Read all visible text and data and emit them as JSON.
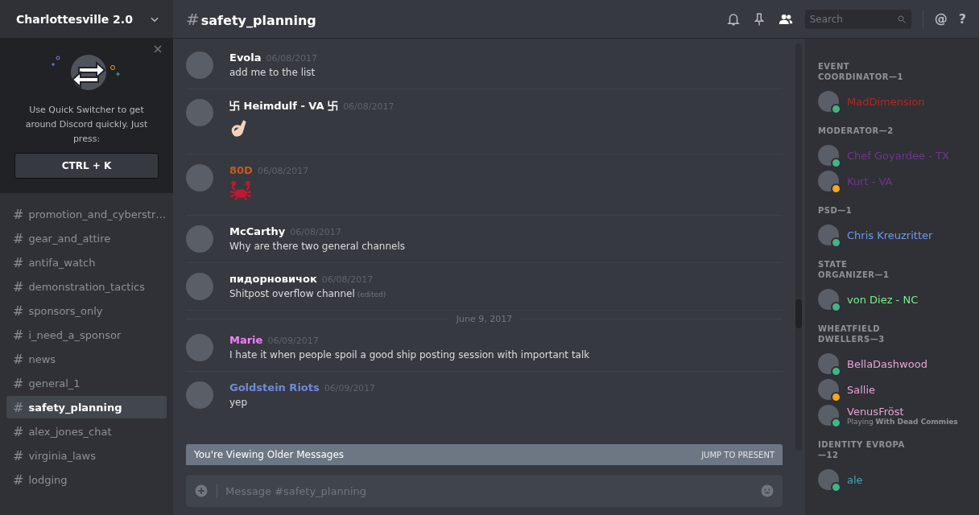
{
  "server": {
    "name": "Charlottesville 2.0"
  },
  "tip": {
    "text": "Use Quick Switcher to get around Discord quickly. Just press:",
    "shortcut": "CTRL + K"
  },
  "channels": [
    {
      "hash": "#",
      "name": "promotion_and_cyberstr…",
      "selected": false
    },
    {
      "hash": "#",
      "name": "gear_and_attire",
      "selected": false
    },
    {
      "hash": "#",
      "name": "antifa_watch",
      "selected": false
    },
    {
      "hash": "#",
      "name": "demonstration_tactics",
      "selected": false
    },
    {
      "hash": "#",
      "name": "sponsors_only",
      "selected": false
    },
    {
      "hash": "#",
      "name": "i_need_a_sponsor",
      "selected": false
    },
    {
      "hash": "#",
      "name": "news",
      "selected": false
    },
    {
      "hash": "#",
      "name": "general_1",
      "selected": false
    },
    {
      "hash": "#",
      "name": "safety_planning",
      "selected": true
    },
    {
      "hash": "#",
      "name": "alex_jones_chat",
      "selected": false
    },
    {
      "hash": "#",
      "name": "virginia_laws",
      "selected": false
    },
    {
      "hash": "#",
      "name": "lodging",
      "selected": false
    }
  ],
  "channel_header": {
    "hash": "#",
    "name": "safety_planning",
    "search_placeholder": "Search",
    "mention": "@",
    "help": "?"
  },
  "messages": [
    {
      "kind": "text",
      "author": "Evola",
      "color": "#ffffff",
      "time": "06/08/2017",
      "text": "add me to the list"
    },
    {
      "kind": "hand",
      "author": "卐 Heimdulf - VA 卐",
      "color": "#ffffff",
      "time": "06/08/2017"
    },
    {
      "kind": "crab",
      "author": "80D",
      "color": "#c65a1e",
      "time": "06/08/2017"
    },
    {
      "kind": "text",
      "author": "McCarthy",
      "color": "#ffffff",
      "time": "06/08/2017",
      "text": "Why are there two general channels"
    },
    {
      "kind": "text",
      "author": "пидорновичок",
      "color": "#ffffff",
      "time": "06/08/2017",
      "text": "Shitpost overflow channel",
      "edited": "(edited)"
    },
    {
      "kind": "divider",
      "text": "June 9, 2017"
    },
    {
      "kind": "text",
      "author": "Marie",
      "color": "#f47fff",
      "time": "06/09/2017",
      "text": "I hate it when people spoil a good ship posting session with important talk"
    },
    {
      "kind": "text",
      "author": "Goldstein Riots",
      "color": "#7289da",
      "time": "06/09/2017",
      "text": "yep"
    }
  ],
  "older_banner": {
    "text": "You're Viewing Older Messages",
    "action": "JUMP TO PRESENT"
  },
  "composer": {
    "placeholder": "Message #safety_planning"
  },
  "member_groups": [
    {
      "title": "EVENT COORDINATOR—1",
      "members": [
        {
          "kind": "online",
          "name": "MadDimension",
          "color": "#b3291f"
        }
      ]
    },
    {
      "title": "MODERATOR—2",
      "members": [
        {
          "kind": "online",
          "name": "Chef Goyardee - TX",
          "color": "#71368a"
        },
        {
          "kind": "idle",
          "name": "Kurt - VA",
          "color": "#71368a"
        }
      ]
    },
    {
      "title": "PSD—1",
      "members": [
        {
          "kind": "online",
          "name": "Chris Kreuzritter",
          "color": "#6f9bf0"
        }
      ]
    },
    {
      "title": "STATE ORGANIZER—1",
      "members": [
        {
          "kind": "online",
          "name": "von Diez - NC",
          "color": "#7bef8a"
        }
      ]
    },
    {
      "title": "WHEATFIELD DWELLERS—3",
      "members": [
        {
          "kind": "online",
          "name": "BellaDashwood",
          "color": "#e8a3d6"
        },
        {
          "kind": "idle",
          "name": "Sallie",
          "color": "#e8a3d6"
        },
        {
          "kind": "online",
          "name": "VenusFröst",
          "color": "#e8a3d6",
          "activity": "Playing **With Dead Commies**"
        }
      ]
    },
    {
      "title": "IDENTITY EVROPA—12",
      "members": [
        {
          "kind": "online",
          "name": "ale",
          "color": "#3fa8b5"
        }
      ]
    }
  ]
}
